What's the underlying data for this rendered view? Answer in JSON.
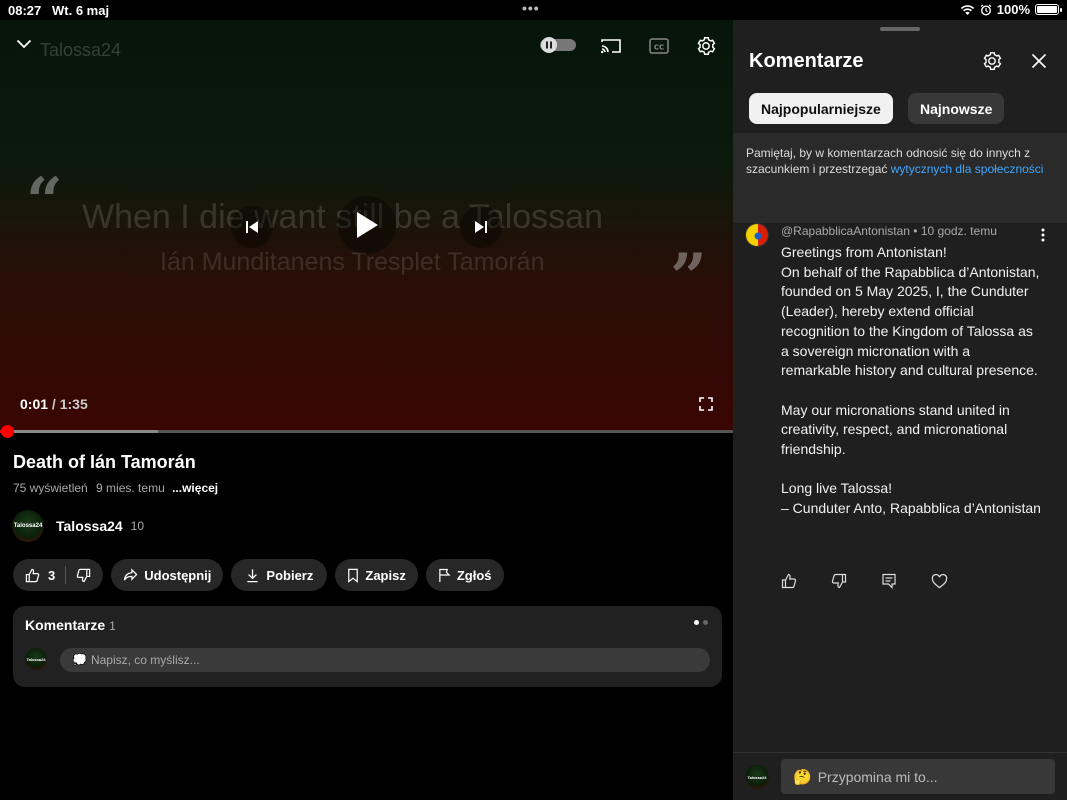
{
  "status_bar": {
    "time": "08:27",
    "date": "Wt. 6 maj",
    "battery": "100%",
    "icons": [
      "wifi-icon",
      "alarm-icon",
      "battery-icon"
    ]
  },
  "player": {
    "overlay_title": "Talossa24",
    "video_line1": "When I die want  still be a Talossan",
    "video_line2": "Ián Munditanens Tresplet Tamorán",
    "current_time": "0:01",
    "separator": " / ",
    "duration": "1:35",
    "progress_fraction": 0.01,
    "buffered_fraction": 0.215,
    "autoplay_on": false
  },
  "video": {
    "title": "Death of Ián Tamorán",
    "views": "75 wyświetleń",
    "age": "9 mies. temu",
    "more_label": "...więcej"
  },
  "channel": {
    "name": "Talossa24",
    "subscribers": "10",
    "avatar_text": "Talossa24"
  },
  "actions": {
    "likes": "3",
    "share": "Udostępnij",
    "download": "Pobierz",
    "save": "Zapisz",
    "report": "Zgłoś"
  },
  "comments_card": {
    "header": "Komentarze",
    "count": "1",
    "placeholder": "Napisz, co myślisz..."
  },
  "panel": {
    "title": "Komentarze",
    "tab_top": "Najpopularniejsze",
    "tab_newest": "Najnowsze",
    "notice_text": "Pamiętaj, by w komentarzach odnosić się do innych z szacunkiem i przestrzegać ",
    "notice_link": "wytycznych dla społeczności",
    "reply_placeholder": "Przypomina mi to..."
  },
  "comment": {
    "author": "@RapabblicaAntonistan",
    "time": "10 godz. temu",
    "lines": [
      "Greetings from Antonistan!",
      "On behalf of the Rapabblica d’Antonistan, founded on 5 May 2025, I, the Cunduter (Leader), hereby extend official recognition to the Kingdom of Talossa as a sovereign micronation with a remarkable history and cultural presence.",
      "",
      "May our micronations stand united in creativity, respect, and micronational friendship.",
      "",
      "Long live Talossa!",
      "– Cunduter Anto, Rapabblica d’Antonistan"
    ]
  },
  "colors": {
    "accent_red": "#ff0000",
    "link_blue": "#3ea6ff",
    "panel_bg": "#1f1f1f"
  }
}
